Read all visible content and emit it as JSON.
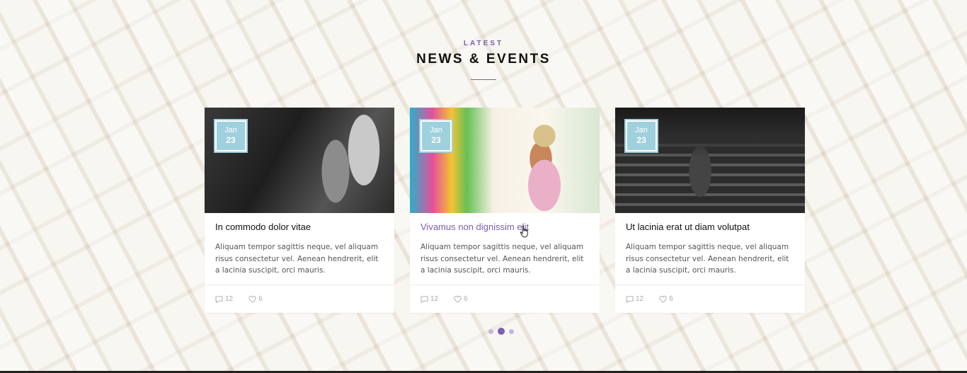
{
  "section": {
    "eyebrow": "LATEST",
    "title": "NEWS & EVENTS"
  },
  "posts": [
    {
      "month": "Jan",
      "day": "23",
      "title": "In commodo dolor vitae",
      "excerpt": "Aliquam tempor sagittis neque, vel aliquam risus consectetur vel. Aenean hendrerit, elit a lacinia suscipit, orci mauris.",
      "comments": "12",
      "likes": "6"
    },
    {
      "month": "Jan",
      "day": "23",
      "title": "Vivamus non dignissim elit",
      "excerpt": "Aliquam tempor sagittis neque, vel aliquam risus consectetur vel. Aenean hendrerit, elit a lacinia suscipit, orci mauris.",
      "comments": "12",
      "likes": "6"
    },
    {
      "month": "Jan",
      "day": "23",
      "title": "Ut lacinia erat ut diam volutpat",
      "excerpt": "Aliquam tempor sagittis neque, vel aliquam risus consectetur vel. Aenean hendrerit, elit a lacinia suscipit, orci mauris.",
      "comments": "12",
      "likes": "6"
    }
  ],
  "carousel": {
    "pages": 3,
    "active_page": 2
  },
  "icons": {
    "comment": "comment-icon",
    "like": "heart-icon",
    "cursor": "pointer-hand-icon"
  },
  "colors": {
    "accent": "#7b5fb0",
    "badge": "#9fd0dd",
    "dot_inactive": "#c4b6e0"
  }
}
